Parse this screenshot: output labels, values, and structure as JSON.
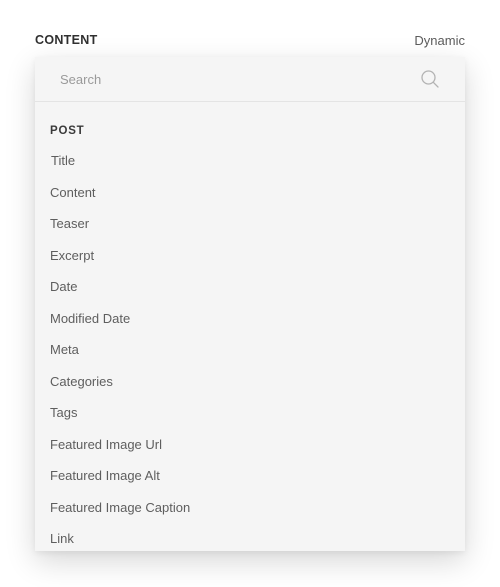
{
  "header": {
    "title": "CONTENT",
    "dynamic_label": "Dynamic"
  },
  "search": {
    "placeholder": "Search",
    "value": "",
    "icon": "search-icon"
  },
  "group": {
    "label": "POST",
    "items": [
      {
        "label": "Title"
      },
      {
        "label": "Content"
      },
      {
        "label": "Teaser"
      },
      {
        "label": "Excerpt"
      },
      {
        "label": "Date"
      },
      {
        "label": "Modified Date"
      },
      {
        "label": "Meta"
      },
      {
        "label": "Categories"
      },
      {
        "label": "Tags"
      },
      {
        "label": "Featured Image Url"
      },
      {
        "label": "Featured Image Alt"
      },
      {
        "label": "Featured Image Caption"
      },
      {
        "label": "Link"
      }
    ]
  }
}
